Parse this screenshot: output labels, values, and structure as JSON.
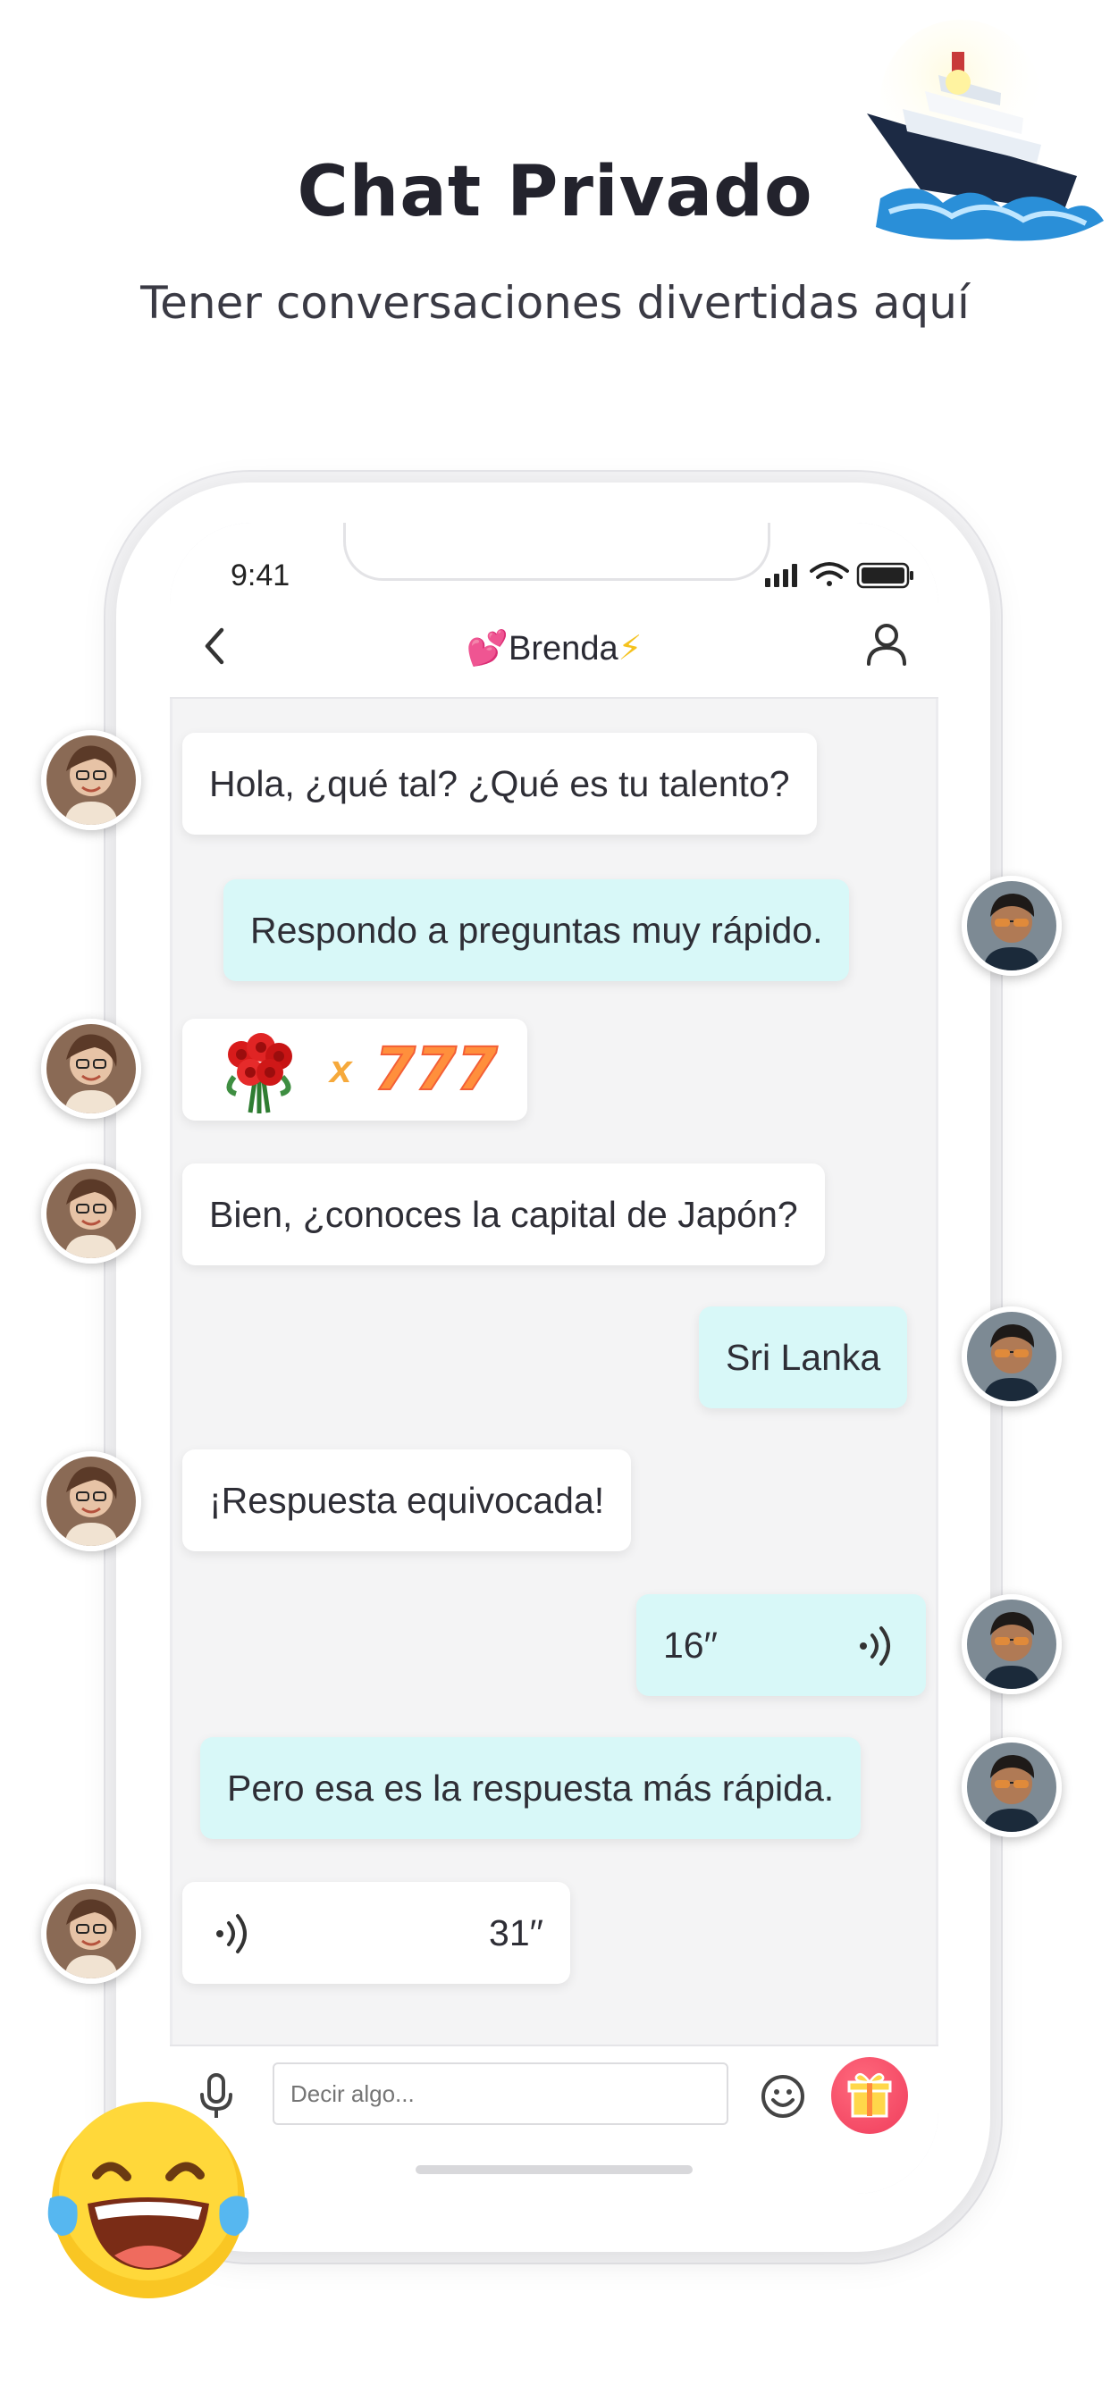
{
  "header": {
    "title": "Chat Privado",
    "subtitle": "Tener conversaciones divertidas aquí"
  },
  "status_bar": {
    "time": "9:41"
  },
  "chat": {
    "contact_emoji_left": "💕",
    "contact_name": "Brenda",
    "contact_emoji_right": "⚡"
  },
  "messages": [
    {
      "from": "contact",
      "text": "Hola, ¿qué tal? ¿Qué es tu talento?"
    },
    {
      "from": "me",
      "text": "Respondo a preguntas muy rápido."
    },
    {
      "from": "contact",
      "type": "gift",
      "gift_icon": "rose-bouquet-icon",
      "multiplier": "x",
      "count": "777"
    },
    {
      "from": "contact",
      "text": "Bien, ¿conoces la capital de Japón?"
    },
    {
      "from": "me",
      "text": "Sri Lanka"
    },
    {
      "from": "contact",
      "text": "¡Respuesta equivocada!"
    },
    {
      "from": "me",
      "type": "voice",
      "duration": "16′′"
    },
    {
      "from": "me",
      "text": "Pero esa es la respuesta más rápida."
    },
    {
      "from": "contact",
      "type": "voice",
      "duration": "31′′"
    }
  ],
  "composer": {
    "placeholder": "Decir algo..."
  },
  "colors": {
    "incoming_bubble": "#ffffff",
    "outgoing_bubble": "#d8f8f8",
    "gift_button": "#f03d5c",
    "chat_background": "#f4f4f5"
  }
}
